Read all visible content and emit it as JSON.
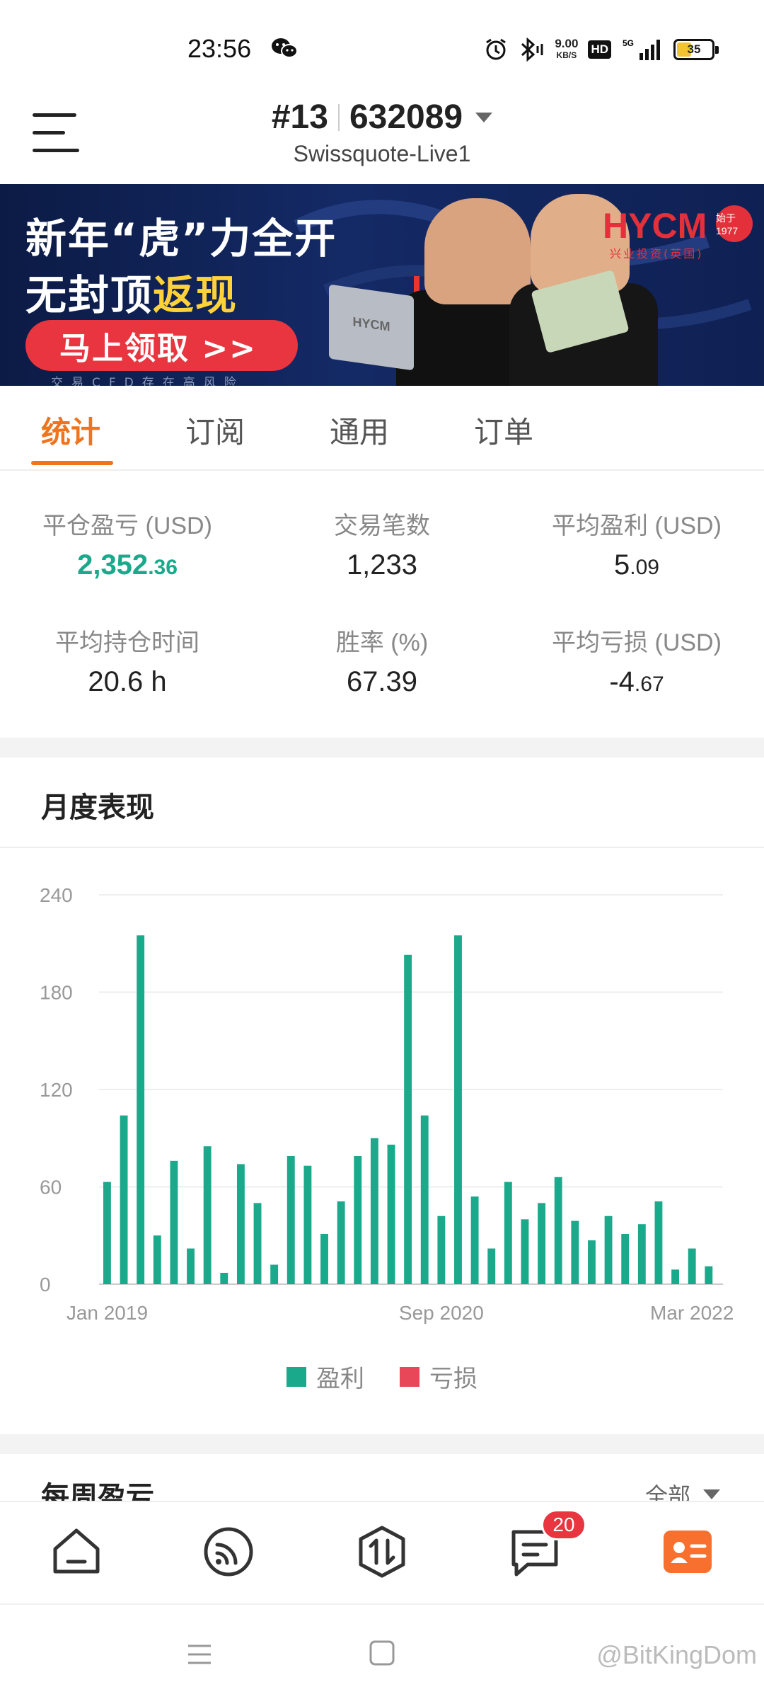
{
  "status_bar": {
    "time": "23:56",
    "net_speed_value": "9.00",
    "net_speed_unit": "KB/S",
    "hd": "HD",
    "network": "5G",
    "battery": "35",
    "icons": [
      "wechat-icon",
      "alarm-icon",
      "bluetooth-icon",
      "signal-icon",
      "battery-icon"
    ]
  },
  "header": {
    "account_rank": "#13",
    "account_id": "632089",
    "server": "Swissquote-Live1"
  },
  "banner": {
    "line1": "新年“虎”力全开",
    "line2_a": "无封顶",
    "line2_b": "返现",
    "cta": "马上领取 >>",
    "risk": "交易CFD存在高风险",
    "brand": "HYCM",
    "brand_sub": "兴业投资(英国)",
    "seal": "始于1977",
    "laptop_text": "HYCM"
  },
  "tabs": [
    {
      "label": "统计",
      "active": true
    },
    {
      "label": "订阅",
      "active": false
    },
    {
      "label": "通用",
      "active": false
    },
    {
      "label": "订单",
      "active": false
    }
  ],
  "stats": {
    "closed_pl": {
      "label": "平仓盈亏 (USD)",
      "int": "2,352",
      "frac": ".36"
    },
    "trades": {
      "label": "交易笔数",
      "value": "1,233"
    },
    "avg_profit": {
      "label": "平均盈利 (USD)",
      "int": "5",
      "frac": ".09"
    },
    "avg_hold": {
      "label": "平均持仓时间",
      "value": "20.6 h"
    },
    "win_rate": {
      "label": "胜率 (%)",
      "value": "67.39"
    },
    "avg_loss": {
      "label": "平均亏损 (USD)",
      "int": "-4",
      "frac": ".67"
    }
  },
  "monthly": {
    "title": "月度表现",
    "legend_profit": "盈利",
    "legend_loss": "亏损"
  },
  "chart_data": {
    "type": "bar",
    "title": "",
    "xlabel": "",
    "ylabel": "",
    "ylim": [
      0,
      240
    ],
    "yticks": [
      "0",
      "60",
      "120",
      "180",
      "240"
    ],
    "xtick_labels": [
      "Jan 2019",
      "Sep 2020",
      "Mar 2022"
    ],
    "colors": {
      "profit": "#1aa98a",
      "loss": "#e8475a"
    },
    "categories": [
      "2019-01",
      "2019-02",
      "2019-03",
      "2019-04",
      "2019-05",
      "2019-06",
      "2019-07",
      "2019-08",
      "2019-09",
      "2019-10",
      "2019-11",
      "2019-12",
      "2020-01",
      "2020-02",
      "2020-03",
      "2020-04",
      "2020-05",
      "2020-06",
      "2020-07",
      "2020-08",
      "2020-09",
      "2020-10",
      "2020-11",
      "2020-12",
      "2021-01",
      "2021-02",
      "2021-03",
      "2021-04",
      "2021-05",
      "2021-06",
      "2021-07",
      "2021-08",
      "2021-09",
      "2021-10",
      "2021-11",
      "2021-12",
      "2022-01",
      "2022-02",
      "2022-03",
      "2022-04"
    ],
    "series": [
      {
        "name": "盈利",
        "values": [
          63,
          104,
          215,
          30,
          76,
          22,
          85,
          7,
          74,
          50,
          12,
          79,
          73,
          31,
          51,
          79,
          90,
          86,
          203,
          104,
          42,
          215,
          54,
          22,
          63,
          40,
          50,
          66,
          39,
          27,
          42,
          31,
          37,
          51,
          9,
          22,
          11
        ]
      },
      {
        "name": "亏损",
        "values": []
      }
    ],
    "grid": true,
    "legend": "bottom"
  },
  "weekly": {
    "title": "每周盈亏",
    "filter": "全部"
  },
  "bottom_nav": {
    "items": [
      "home-icon",
      "feed-icon",
      "trade-icon",
      "message-icon",
      "profile-icon"
    ],
    "badge": "20"
  },
  "system_nav": {
    "watermark": "@BitKingDom"
  }
}
